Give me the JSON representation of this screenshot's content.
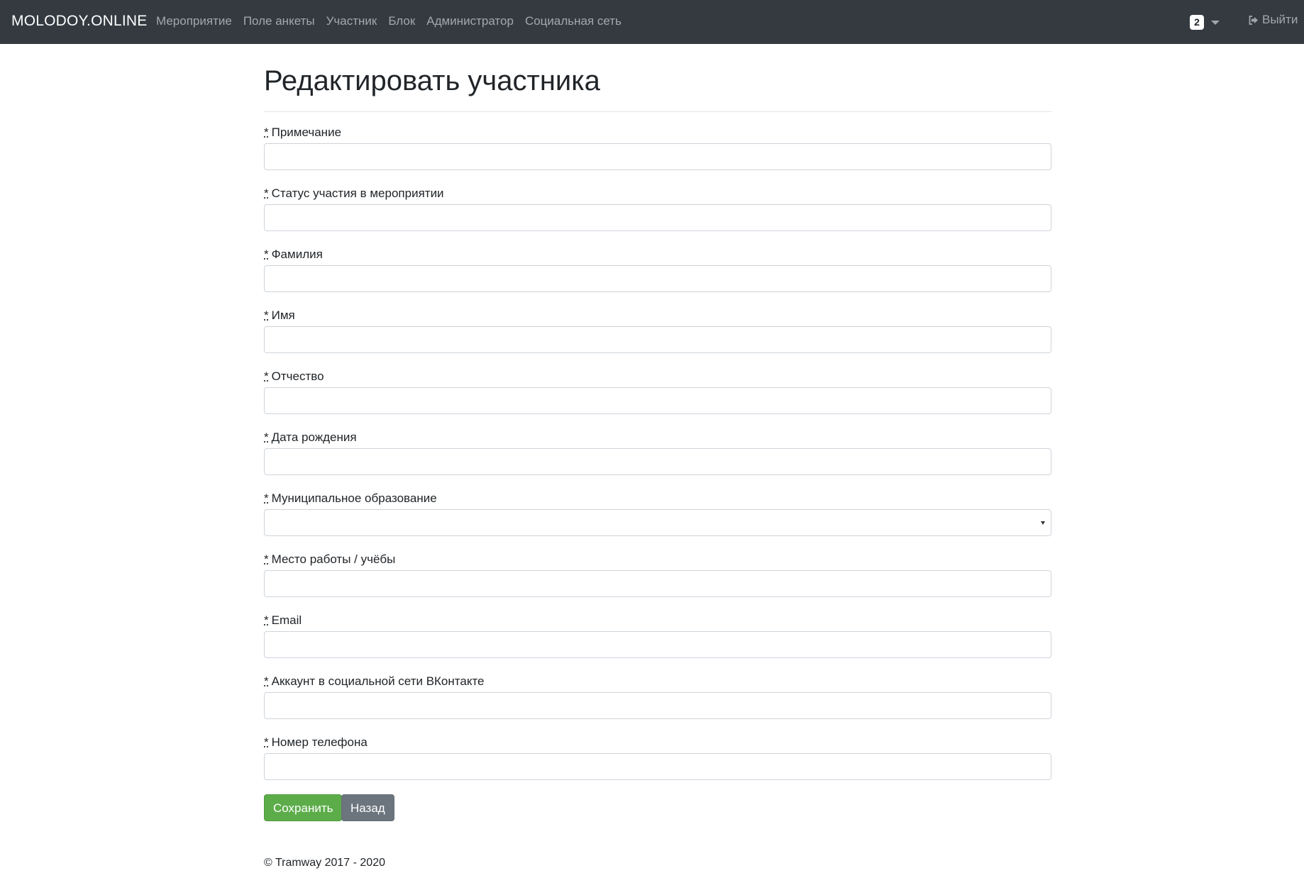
{
  "navbar": {
    "brand": "MOLODOY.ONLINE",
    "links": [
      "Мероприятие",
      "Поле анкеты",
      "Участник",
      "Блок",
      "Администратор",
      "Социальная сеть"
    ],
    "badge_count": "2",
    "logout_label": "Выйти"
  },
  "page": {
    "title": "Редактировать участника"
  },
  "form": {
    "required_mark": "*",
    "fields": [
      {
        "label": "Примечание",
        "type": "text",
        "value": ""
      },
      {
        "label": "Статус участия в мероприятии",
        "type": "text",
        "value": ""
      },
      {
        "label": "Фамилия",
        "type": "text",
        "value": ""
      },
      {
        "label": "Имя",
        "type": "text",
        "value": ""
      },
      {
        "label": "Отчество",
        "type": "text",
        "value": ""
      },
      {
        "label": "Дата рождения",
        "type": "text",
        "value": ""
      },
      {
        "label": "Муниципальное образование",
        "type": "select",
        "value": ""
      },
      {
        "label": "Место работы / учёбы",
        "type": "text",
        "value": ""
      },
      {
        "label": "Email",
        "type": "text",
        "value": ""
      },
      {
        "label": "Аккаунт в социальной сети ВКонтакте",
        "type": "text",
        "value": ""
      },
      {
        "label": "Номер телефона",
        "type": "text",
        "value": ""
      }
    ],
    "save_label": "Сохранить",
    "back_label": "Назад"
  },
  "footer": {
    "copyright": "© Tramway 2017 - 2020"
  },
  "colors": {
    "navbar_bg": "#343a40",
    "save_button": "#5cad4a",
    "back_button": "#6c757d"
  },
  "icons": {
    "logout": "sign-out-icon",
    "dropdown": "caret-down-icon"
  }
}
